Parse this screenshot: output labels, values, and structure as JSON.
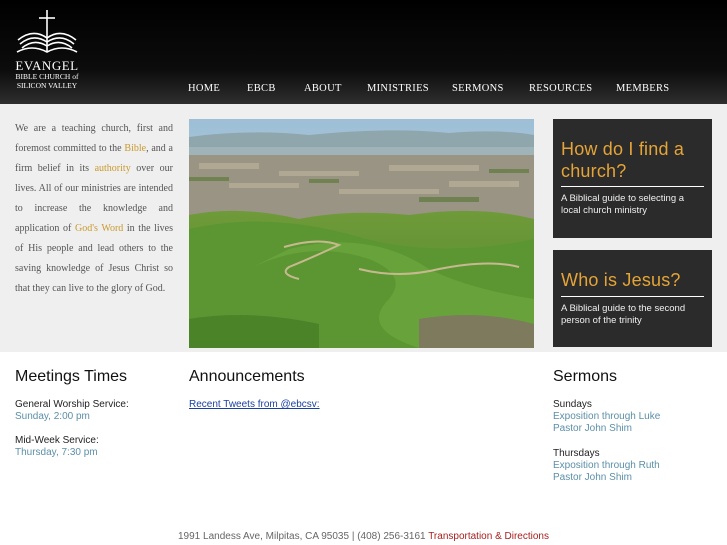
{
  "logo": {
    "name": "EVANGEL",
    "line1": "BIBLE CHURCH of",
    "line2": "SILICON VALLEY",
    "icon": "cross-bible-icon"
  },
  "nav": [
    "HOME",
    "EBCB",
    "ABOUT",
    "MINISTRIES",
    "SERMONS",
    "RESOURCES",
    "MEMBERS"
  ],
  "mission": {
    "p1": "We are a teaching church, first and foremost committed to the ",
    "link_bible": "Bible",
    "p2": ", and a firm belief in its ",
    "link_authority": "authority",
    "p3": " over our lives. All of our ministries are intended to increase the knowledge and application of ",
    "link_word": "God's Word",
    "p4": " in the lives of His people and lead others to the saving knowledge of Jesus Christ so that they can live to the glory of God."
  },
  "promos": [
    {
      "title": "How do I find a church?",
      "desc": "A Biblical guide to selecting a local church ministry"
    },
    {
      "title": "Who is Jesus?",
      "desc": "A Biblical guide to the second person of the trinity"
    }
  ],
  "meetings": {
    "title": "Meetings Times",
    "general_label": "General Worship Service:",
    "general_time": "Sunday, 2:00 pm",
    "midweek_label": "Mid-Week Service:",
    "midweek_time": "Thursday, 7:30 pm"
  },
  "announcements": {
    "title": "Announcements",
    "tweets_link": "Recent Tweets from @ebcsv:"
  },
  "sermons": {
    "title": "Sermons",
    "sunday_label": "Sundays",
    "sunday_series": "Exposition through Luke",
    "sunday_pastor": "Pastor John Shim",
    "thursday_label": "Thursdays",
    "thursday_series": "Exposition through Ruth",
    "thursday_pastor": "Pastor John Shim"
  },
  "footer": {
    "address": "1991 Landess Ave, Milpitas, CA 95035 | (408) 256-3161 ",
    "directions": "Transportation & Directions"
  },
  "colors": {
    "accent": "#e5a437",
    "link_blue": "#5b8fa8",
    "promo_bg": "#2b2b2b",
    "footer_link": "#a81e1e"
  }
}
